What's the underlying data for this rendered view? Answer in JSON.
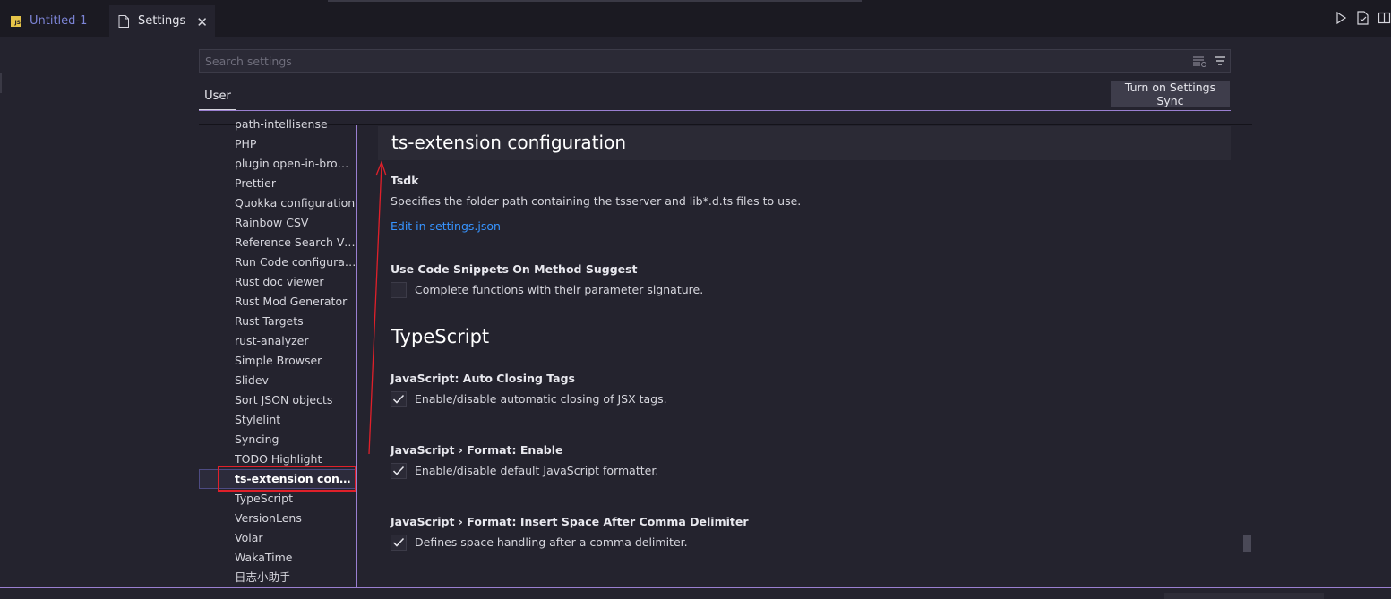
{
  "tabs": [
    {
      "label": "Untitled-1",
      "badge": "JS",
      "icon": "js-file-icon"
    },
    {
      "label": "Settings",
      "icon": "settings-file-icon",
      "close": "✕"
    }
  ],
  "tab_actions": [
    "run-icon",
    "open-settings-json-icon",
    "split-editor-icon"
  ],
  "search": {
    "placeholder": "Search settings",
    "value": ""
  },
  "header": {
    "user_tab": "User",
    "sync_button": "Turn on Settings Sync"
  },
  "toc": {
    "items": [
      "path-intellisense",
      "PHP",
      "plugin open-in-browser",
      "Prettier",
      "Quokka configuration",
      "Rainbow CSV",
      "Reference Search View",
      "Run Code configuration",
      "Rust doc viewer",
      "Rust Mod Generator",
      "Rust Targets",
      "rust-analyzer",
      "Simple Browser",
      "Slidev",
      "Sort JSON objects",
      "Stylelint",
      "Syncing",
      "TODO Highlight",
      "ts-extension configuration",
      "TypeScript",
      "VersionLens",
      "Volar",
      "WakaTime",
      "日志小助手"
    ],
    "active": "ts-extension configuration"
  },
  "content": {
    "section_title": "ts-extension configuration",
    "tsdk": {
      "title": "Tsdk",
      "description": "Specifies the folder path containing the tsserver and lib*.d.ts files to use.",
      "link": "Edit in settings.json"
    },
    "snippets": {
      "title": "Use Code Snippets On Method Suggest",
      "description": "Complete functions with their parameter signature.",
      "checked": false
    },
    "group_title": "TypeScript",
    "auto_closing": {
      "title": "JavaScript: Auto Closing Tags",
      "description": "Enable/disable automatic closing of JSX tags.",
      "checked": true
    },
    "format_enable": {
      "title": "JavaScript › Format: Enable",
      "description": "Enable/disable default JavaScript formatter.",
      "checked": true
    },
    "comma": {
      "title": "JavaScript › Format: Insert Space After Comma Delimiter",
      "description": "Defines space handling after a comma delimiter.",
      "checked": true
    }
  },
  "colors": {
    "accent": "#9a7fd0",
    "annotation": "#e0202a",
    "link": "#3794ff"
  }
}
